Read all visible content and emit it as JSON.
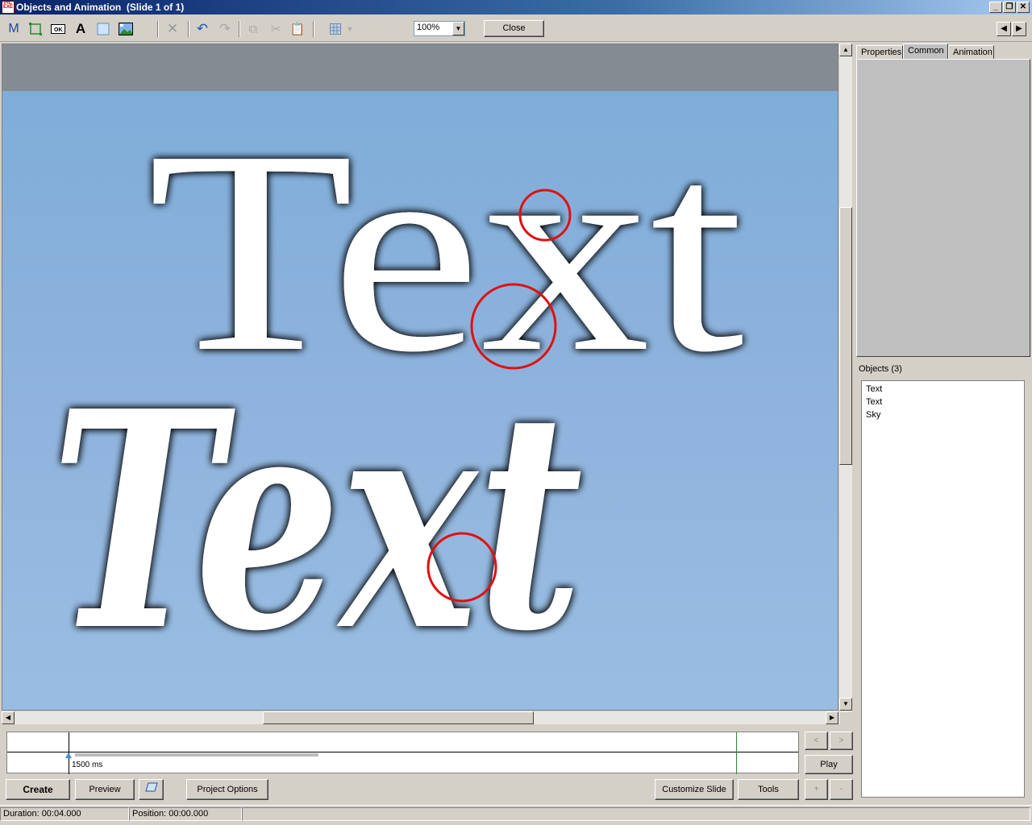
{
  "window": {
    "title": "Objects and Animation  (Slide 1 of 1)",
    "app_icon_text": "PIC EXE"
  },
  "toolbar": {
    "zoom_value": "100%",
    "close_label": "Close"
  },
  "canvas": {
    "upright_text": "Text",
    "script_text": "Text",
    "text_color": "#ffffff",
    "sky_color": "#84a9d6",
    "marker_color": "#e01010"
  },
  "right_panel": {
    "tabs": [
      {
        "label": "Properties"
      },
      {
        "label": "Common"
      },
      {
        "label": "Animation"
      }
    ],
    "objects_label": "Objects (3)",
    "objects": [
      {
        "label": "Text"
      },
      {
        "label": "Text"
      },
      {
        "label": "Sky"
      }
    ]
  },
  "timeline": {
    "time_label": "1500 ms"
  },
  "buttons": {
    "create": "Create",
    "preview": "Preview",
    "project_options": "Project Options",
    "customize_slide": "Customize Slide",
    "tools": "Tools",
    "play": "Play",
    "prev": "<",
    "next": ">",
    "plus": "+",
    "minus": "-"
  },
  "status": {
    "duration": "Duration:  00:04.000",
    "position": "Position:  00:00.000"
  }
}
